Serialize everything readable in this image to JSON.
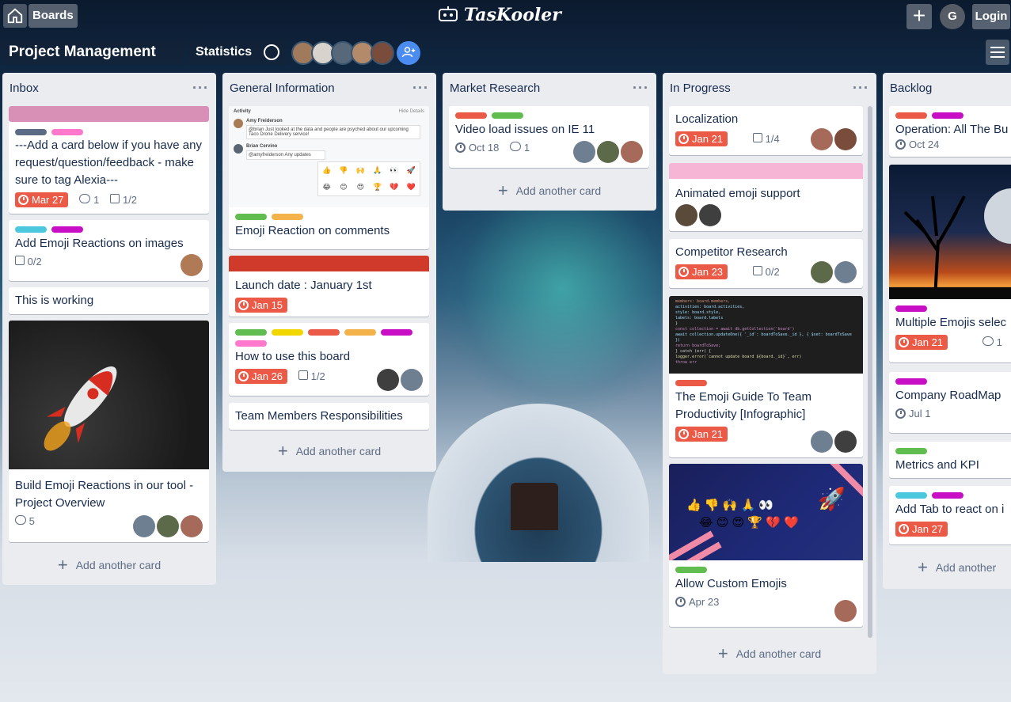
{
  "header": {
    "boards_label": "Boards",
    "app_name": "TasKooler",
    "user_initial": "G",
    "login_label": "Login"
  },
  "board": {
    "title": "Project Management",
    "stats_label": "Statistics"
  },
  "add_card_label": "Add another card",
  "lists": {
    "inbox": {
      "title": "Inbox",
      "c1": {
        "title": "---Add a card below if you have any request/question/feedback - make sure to tag Alexia---",
        "due": "Mar 27",
        "comments": "1",
        "checklist": "1/2"
      },
      "c2": {
        "title": "Add Emoji Reactions on images",
        "checklist": "0/2"
      },
      "c3": {
        "title": "This is working"
      },
      "c4": {
        "title": "Build Emoji Reactions in our tool - Project Overview",
        "comments": "5"
      }
    },
    "general": {
      "title": "General Information",
      "c1": {
        "title": "Emoji Reaction on comments"
      },
      "c2": {
        "title": "Launch date : January 1st",
        "due": "Jan 15"
      },
      "c3": {
        "title": "How to use this board",
        "due": "Jan 26",
        "checklist": "1/2"
      },
      "c4": {
        "title": "Team Members Responsibilities"
      },
      "activity": {
        "heading": "Activity",
        "hide": "Hide Details",
        "user1": "Amy Freiderson",
        "msg1": "@brian Just looked at the data and people are psyched about our upcoming Taco Drone Delivery service!",
        "user2": "Brian Cervino",
        "msg2": "@amyfreiderson Any updates"
      }
    },
    "market": {
      "title": "Market Research",
      "c1": {
        "title": "Video load issues on IE 11",
        "date": "Oct 18",
        "comments": "1"
      }
    },
    "progress": {
      "title": "In Progress",
      "c1": {
        "title": "Localization",
        "due": "Jan 21",
        "checklist": "1/4"
      },
      "c2": {
        "title": "Animated emoji support"
      },
      "c3": {
        "title": "Competitor Research",
        "due": "Jan 23",
        "checklist": "0/2"
      },
      "c4": {
        "title": "The Emoji Guide To Team Productivity [Infographic]",
        "due": "Jan 21"
      },
      "c5": {
        "title": "Allow Custom Emojis",
        "date": "Apr 23"
      }
    },
    "backlog": {
      "title": "Backlog",
      "c1": {
        "title": "Operation: All The Bu",
        "date": "Oct 24"
      },
      "c2": {
        "title": "Multiple Emojis selec",
        "due": "Jan 21",
        "comments": "1"
      },
      "c3": {
        "title": "Company RoadMap",
        "date": "Jul 1"
      },
      "c4": {
        "title": "Metrics and KPI"
      },
      "c5": {
        "title": "Add Tab to react on i",
        "due": "Jan 27"
      },
      "add": "Add another"
    }
  },
  "label_colors": {
    "green": "#61bd4f",
    "yellow": "#f2d600",
    "orange": "#ff9f1a",
    "red": "#eb5a46",
    "purple": "#c377e0",
    "magenta": "#c90fc6",
    "pink": "#ff78cb",
    "slate": "#5b6b86",
    "sky": "#00c2e0",
    "lightpink": "#f7b5d5",
    "darkred": "#cf3a2a",
    "rose": "#d890b6"
  }
}
